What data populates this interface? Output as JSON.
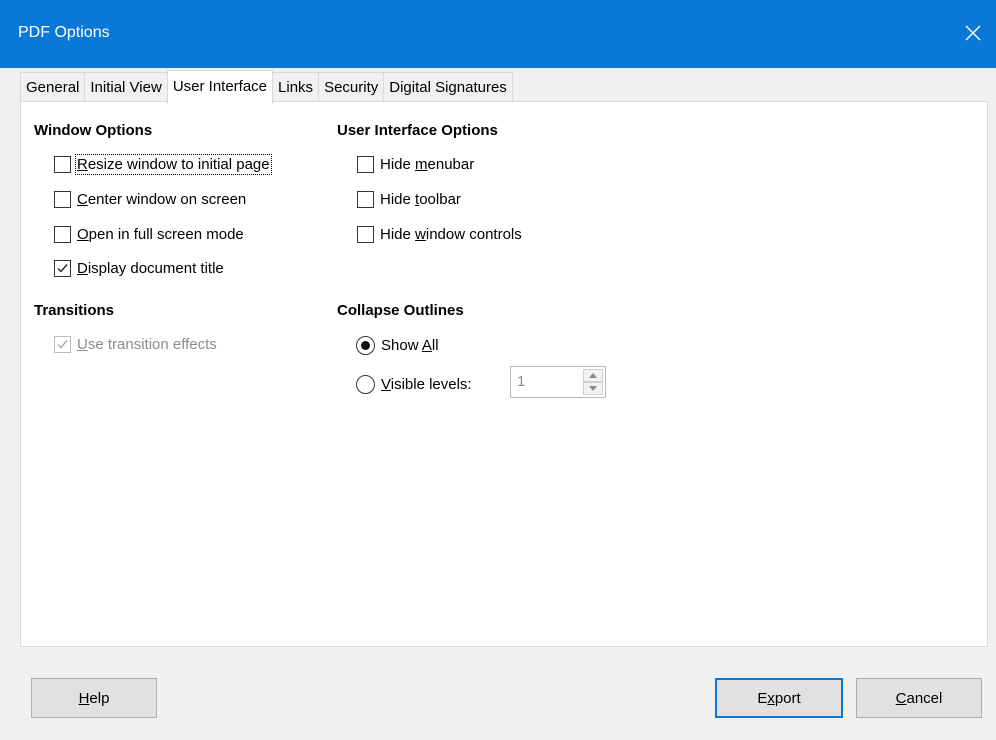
{
  "window": {
    "title": "PDF Options",
    "close_icon": "close-icon"
  },
  "tabs": [
    {
      "label": "General",
      "active": false
    },
    {
      "label": "Initial View",
      "active": false
    },
    {
      "label": "User Interface",
      "active": true
    },
    {
      "label": "Links",
      "active": false
    },
    {
      "label": "Security",
      "active": false
    },
    {
      "label": "Digital Signatures",
      "active": false
    }
  ],
  "window_options": {
    "title": "Window Options",
    "items": [
      {
        "pre": "",
        "ul": "R",
        "post": "esize window to initial page",
        "checked": false,
        "focused": true
      },
      {
        "pre": "",
        "ul": "C",
        "post": "enter window on screen",
        "checked": false
      },
      {
        "pre": "",
        "ul": "O",
        "post": "pen in full screen mode",
        "checked": false
      },
      {
        "pre": "",
        "ul": "D",
        "post": "isplay document title",
        "checked": true
      }
    ]
  },
  "ui_options": {
    "title": "User Interface Options",
    "items": [
      {
        "pre": "Hide ",
        "ul": "m",
        "post": "enubar",
        "checked": false
      },
      {
        "pre": "Hide ",
        "ul": "t",
        "post": "oolbar",
        "checked": false
      },
      {
        "pre": "Hide ",
        "ul": "w",
        "post": "indow controls",
        "checked": false
      }
    ]
  },
  "transitions": {
    "title": "Transitions",
    "item": {
      "pre": "",
      "ul": "U",
      "post": "se transition effects",
      "checked": true,
      "disabled": true
    }
  },
  "collapse_outlines": {
    "title": "Collapse Outlines",
    "show_all": {
      "pre": "Show ",
      "ul": "A",
      "post": "ll",
      "selected": true
    },
    "visible_levels": {
      "pre": "",
      "ul": "V",
      "post": "isible levels:",
      "selected": false
    },
    "levels_value": "1"
  },
  "buttons": {
    "help": {
      "ul": "H",
      "post": "elp"
    },
    "export": {
      "pre": "E",
      "ul": "x",
      "post": "port"
    },
    "cancel": {
      "ul": "C",
      "post": "ancel"
    }
  },
  "colors": {
    "accent": "#0a78d7",
    "panel": "#ffffff",
    "background": "#f0f0f0"
  }
}
